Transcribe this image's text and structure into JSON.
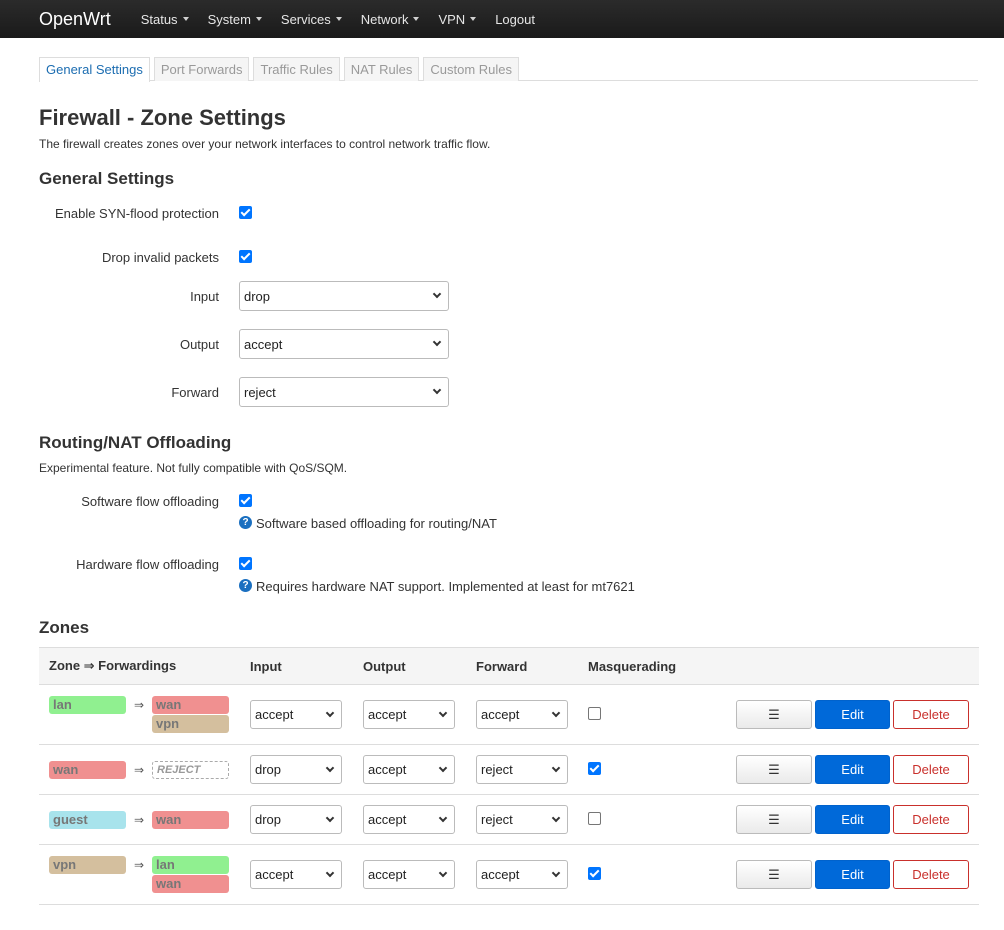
{
  "nav": {
    "brand": "OpenWrt",
    "items": [
      {
        "label": "Status",
        "dropdown": true
      },
      {
        "label": "System",
        "dropdown": true
      },
      {
        "label": "Services",
        "dropdown": true
      },
      {
        "label": "Network",
        "dropdown": true
      },
      {
        "label": "VPN",
        "dropdown": true
      },
      {
        "label": "Logout",
        "dropdown": false
      }
    ]
  },
  "tabs": [
    "General Settings",
    "Port Forwards",
    "Traffic Rules",
    "NAT Rules",
    "Custom Rules"
  ],
  "page": {
    "title": "Firewall - Zone Settings",
    "description": "The firewall creates zones over your network interfaces to control network traffic flow."
  },
  "general": {
    "heading": "General Settings",
    "syn_label": "Enable SYN-flood protection",
    "syn_checked": true,
    "drop_label": "Drop invalid packets",
    "drop_checked": true,
    "input_label": "Input",
    "input_value": "drop",
    "output_label": "Output",
    "output_value": "accept",
    "forward_label": "Forward",
    "forward_value": "reject"
  },
  "offload": {
    "heading": "Routing/NAT Offloading",
    "description": "Experimental feature. Not fully compatible with QoS/SQM.",
    "sw_label": "Software flow offloading",
    "sw_checked": true,
    "sw_help": "Software based offloading for routing/NAT",
    "hw_label": "Hardware flow offloading",
    "hw_checked": true,
    "hw_help": "Requires hardware NAT support. Implemented at least for mt7621"
  },
  "zones": {
    "heading": "Zones",
    "headers": [
      "Zone ⇒ Forwardings",
      "Input",
      "Output",
      "Forward",
      "Masquerading"
    ],
    "arrow": "⇒",
    "buttons": {
      "menu": "☰",
      "edit": "Edit",
      "delete": "Delete"
    },
    "rows": [
      {
        "zone": "lan",
        "color": "green",
        "dest": [
          {
            "name": "wan",
            "color": "red"
          },
          {
            "name": "vpn",
            "color": "tan"
          }
        ],
        "input": "accept",
        "output": "accept",
        "forward": "accept",
        "masq": false
      },
      {
        "zone": "wan",
        "color": "red",
        "dest": [
          {
            "name": "REJECT",
            "color": "reject"
          }
        ],
        "input": "drop",
        "output": "accept",
        "forward": "reject",
        "masq": true
      },
      {
        "zone": "guest",
        "color": "cyan",
        "dest": [
          {
            "name": "wan",
            "color": "red"
          }
        ],
        "input": "drop",
        "output": "accept",
        "forward": "reject",
        "masq": false
      },
      {
        "zone": "vpn",
        "color": "tan",
        "dest": [
          {
            "name": "lan",
            "color": "green"
          },
          {
            "name": "wan",
            "color": "red"
          }
        ],
        "input": "accept",
        "output": "accept",
        "forward": "accept",
        "masq": true
      }
    ]
  }
}
